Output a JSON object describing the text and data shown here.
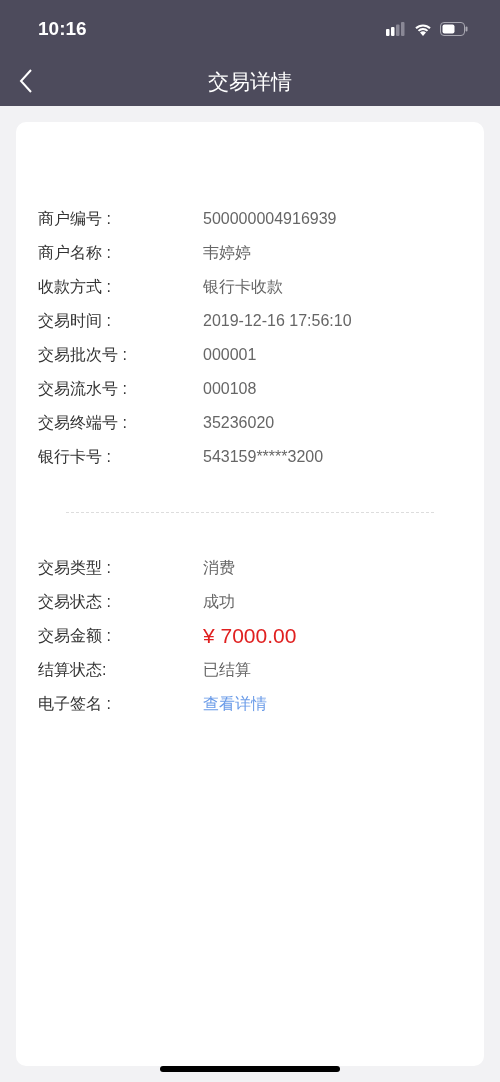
{
  "status_bar": {
    "time": "10:16"
  },
  "nav": {
    "title": "交易详情"
  },
  "sections": [
    {
      "rows": [
        {
          "label": "商户编号 :",
          "value": "500000004916939",
          "kind": "text"
        },
        {
          "label": "商户名称 :",
          "value": "韦婷婷",
          "kind": "text"
        },
        {
          "label": "收款方式 :",
          "value": "银行卡收款",
          "kind": "text"
        },
        {
          "label": "交易时间 :",
          "value": "2019-12-16 17:56:10",
          "kind": "text"
        },
        {
          "label": "交易批次号 :",
          "value": "000001",
          "kind": "text"
        },
        {
          "label": "交易流水号 :",
          "value": "000108",
          "kind": "text"
        },
        {
          "label": "交易终端号 :",
          "value": "35236020",
          "kind": "text"
        },
        {
          "label": "银行卡号 :",
          "value": "543159*****3200",
          "kind": "text"
        }
      ]
    },
    {
      "rows": [
        {
          "label": "交易类型 :",
          "value": "消费",
          "kind": "text"
        },
        {
          "label": "交易状态 :",
          "value": "成功",
          "kind": "text"
        },
        {
          "label": "交易金额 :",
          "value": "¥ 7000.00",
          "kind": "amount"
        },
        {
          "label": "结算状态:",
          "value": "已结算",
          "kind": "text"
        },
        {
          "label": "电子签名 :",
          "value": "查看详情",
          "kind": "link"
        }
      ]
    }
  ]
}
